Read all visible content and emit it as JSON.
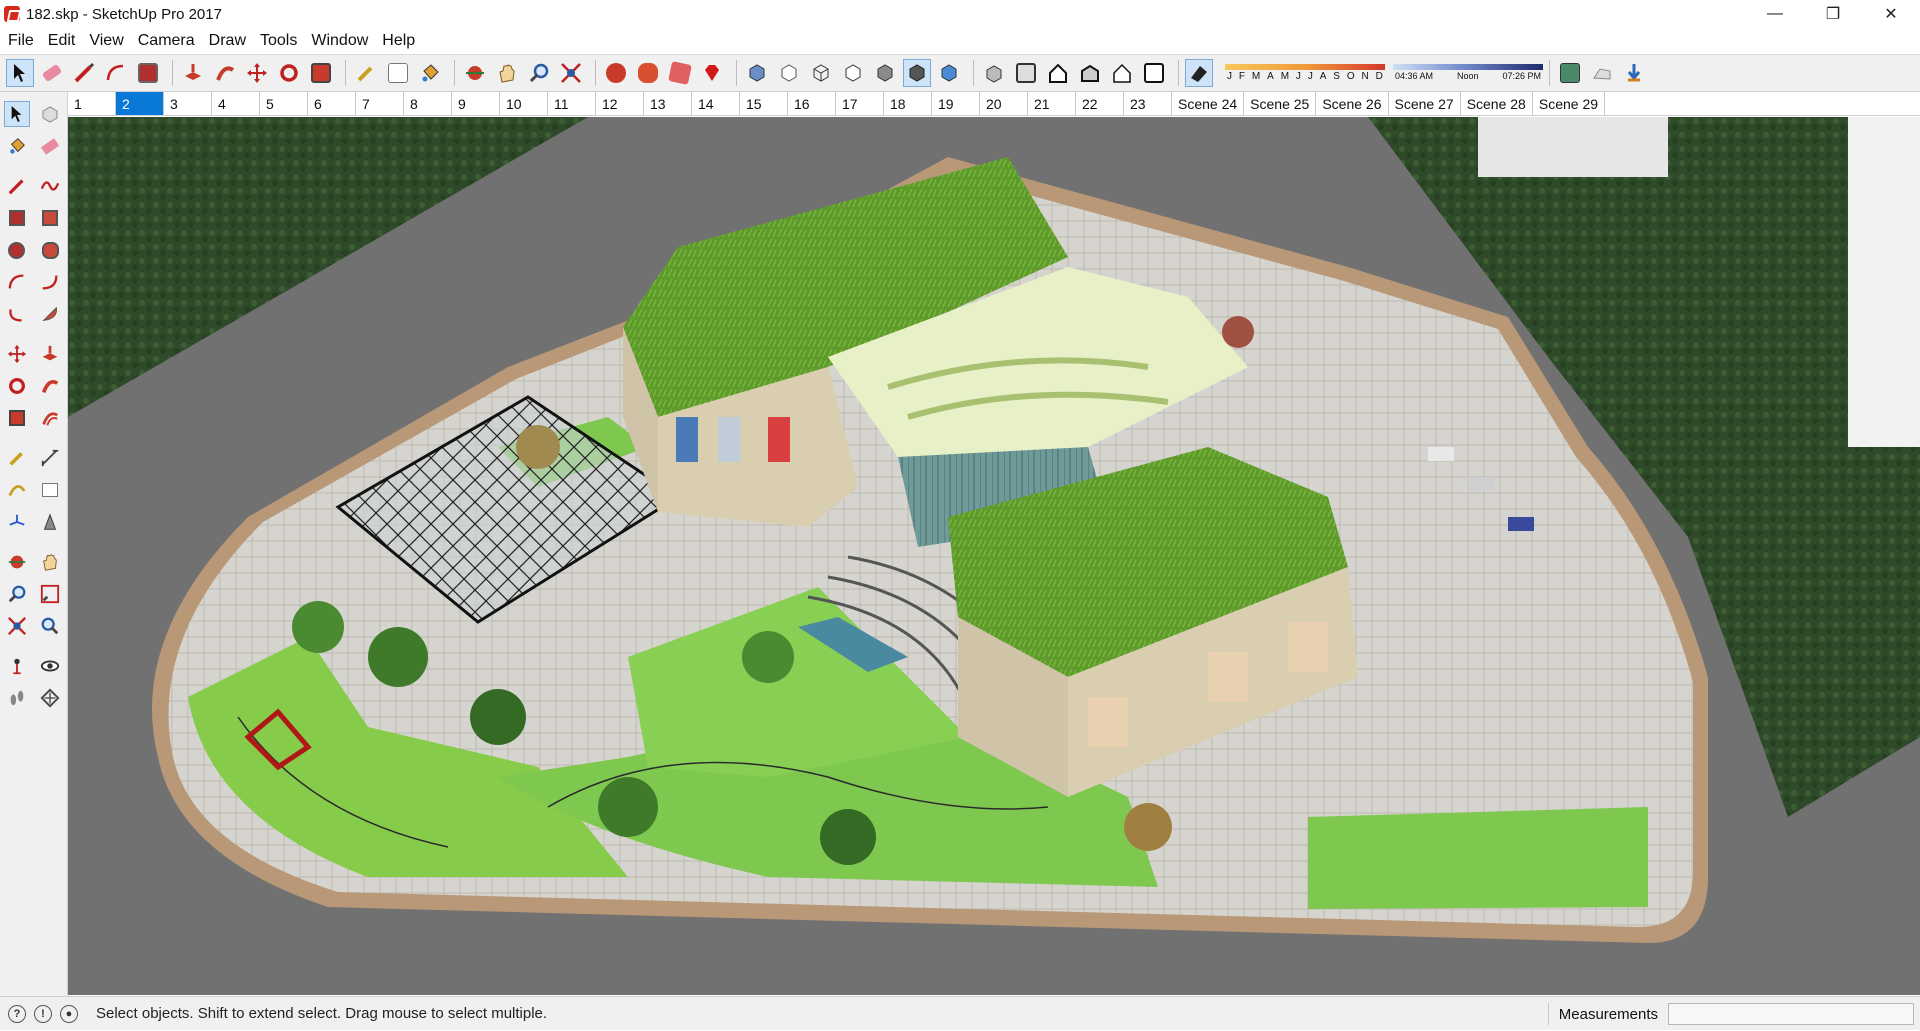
{
  "window": {
    "title": "182.skp - SketchUp Pro 2017",
    "minimize_glyph": "—",
    "restore_glyph": "❐",
    "close_glyph": "✕"
  },
  "menu": {
    "items": [
      "File",
      "Edit",
      "View",
      "Camera",
      "Draw",
      "Tools",
      "Window",
      "Help"
    ]
  },
  "shadows": {
    "months": [
      "J",
      "F",
      "M",
      "A",
      "M",
      "J",
      "J",
      "A",
      "S",
      "O",
      "N",
      "D"
    ],
    "time_start": "04:36 AM",
    "time_mid": "Noon",
    "time_end": "07:26 PM"
  },
  "scenes": {
    "selected": "2",
    "tabs": [
      "1",
      "2",
      "3",
      "4",
      "5",
      "6",
      "7",
      "8",
      "9",
      "10",
      "11",
      "12",
      "13",
      "14",
      "15",
      "16",
      "17",
      "18",
      "19",
      "20",
      "21",
      "22",
      "23",
      "Scene 24",
      "Scene 25",
      "Scene 26",
      "Scene 27",
      "Scene 28",
      "Scene 29"
    ]
  },
  "status": {
    "message": "Select objects. Shift to extend select. Drag mouse to select multiple.",
    "measurements_label": "Measurements",
    "measurements_value": ""
  },
  "colors": {
    "accent": "#0a78d7",
    "road": "#6f6f6f",
    "lawn": "#7ec850",
    "roof_green": "#5f9a2e",
    "paving": "#d8d6d0"
  }
}
